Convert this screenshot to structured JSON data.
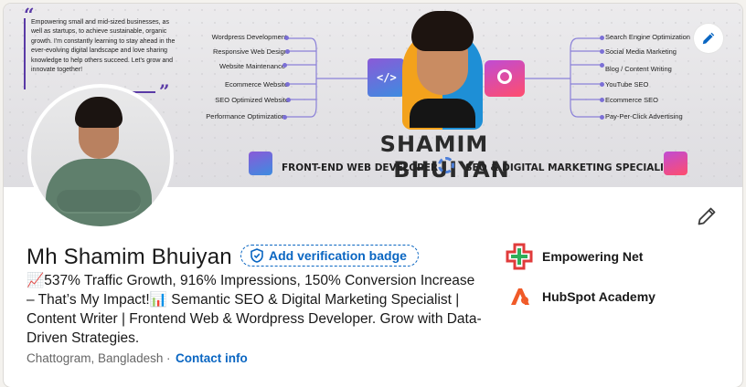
{
  "banner": {
    "quote_text": "Empowering small and mid-sized businesses, as well as startups, to achieve sustainable, organic growth. I'm constantly learning to stay ahead in the ever-evolving digital landscape and love sharing knowledge to help others succeed. Let's grow and innovate together!",
    "left_skills": [
      "Wordpress Development",
      "Responsive Web Design",
      "Website Maintenance",
      "Ecommerce Website",
      "SEO Optimized Website",
      "Performance Optimization"
    ],
    "right_skills": [
      "Search Engine Optimization",
      "Social Media Marketing",
      "Blog / Content Writing",
      "YouTube SEO",
      "Ecommerce SEO",
      "Pay-Per-Click Advertising"
    ],
    "name_first": "SHAMIM",
    "name_last": "BHUIYAN",
    "tagline_left": "FRONT-END WEB DEVELOPER",
    "tagline_right": "SEO & DIGITAL MARKETING SPECIALIST",
    "code_icon_glyph": "</>"
  },
  "profile": {
    "name": "Mh Shamim Bhuiyan",
    "verification_label": "Add verification badge",
    "headline": "📈537% Traffic Growth, 916% Impressions, 150% Conversion Increase – That’s My Impact!📊 Semantic SEO & Digital Marketing Specialist | Content Writer | Frontend Web & Wordpress Developer. Grow with Data-Driven Strategies.",
    "location": "Chattogram, Bangladesh",
    "separator": "·",
    "contact_label": "Contact info"
  },
  "experience": [
    {
      "name": "Empowering Net",
      "logo": "cross-logo-icon"
    },
    {
      "name": "HubSpot Academy",
      "logo": "hubspot-academy-icon"
    }
  ],
  "icons": {
    "banner_edit": "pencil-icon",
    "profile_edit": "pencil-icon",
    "verify": "shield-check-icon"
  },
  "colors": {
    "link_blue": "#0a66c2",
    "banner_accent": "#5a3aa6",
    "empowering_red": "#e03b3b",
    "empowering_green": "#2fae5a",
    "hubspot_orange": "#f05a28"
  }
}
